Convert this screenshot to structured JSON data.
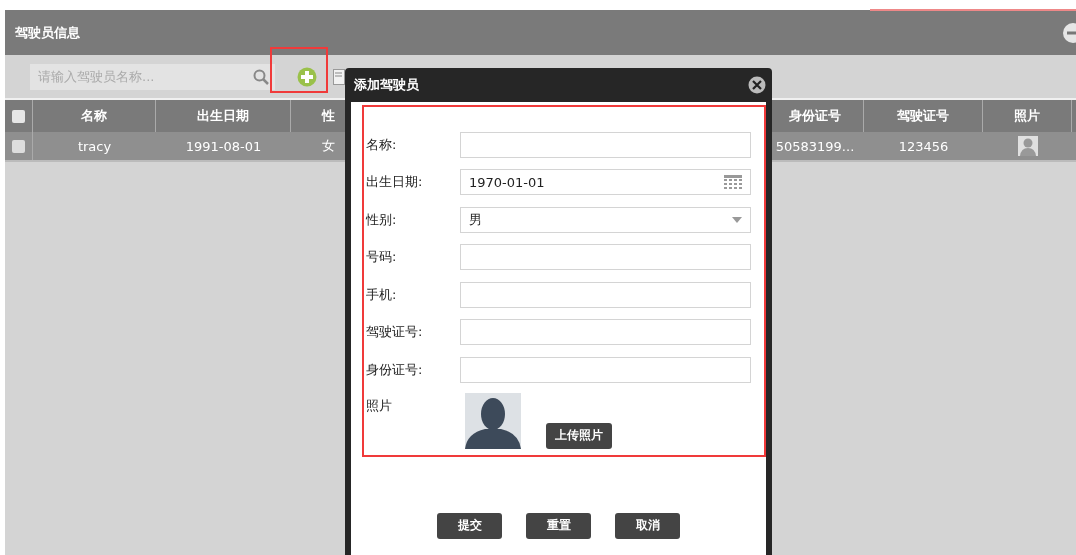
{
  "panel": {
    "title": "驾驶员信息"
  },
  "toolbar": {
    "search": {
      "placeholder": "请输入驾驶员名称..."
    }
  },
  "table": {
    "columns": [
      {
        "label": "名称",
        "kind": "text"
      },
      {
        "label": "出生日期",
        "kind": "text"
      },
      {
        "label": "性",
        "kind": "partial"
      },
      {
        "label": "身份证号",
        "kind": "text"
      },
      {
        "label": "驾驶证号",
        "kind": "text"
      },
      {
        "label": "照片",
        "kind": "photo"
      }
    ],
    "header_checked": false,
    "rows": [
      {
        "checked": false,
        "cells": [
          "tracy",
          "1991-08-01",
          "女",
          "50583199...",
          "123456"
        ]
      }
    ]
  },
  "dialog": {
    "title": "添加驾驶员",
    "fields": [
      {
        "kind": "text",
        "label": "名称:"
      },
      {
        "kind": "date",
        "label": "出生日期:",
        "value": "1970-01-01"
      },
      {
        "kind": "select",
        "label": "性别:",
        "value": "男"
      },
      {
        "kind": "text",
        "label": "号码:"
      },
      {
        "kind": "text",
        "label": "手机:"
      },
      {
        "kind": "text",
        "label": "驾驶证号:"
      },
      {
        "kind": "text",
        "label": "身份证号:"
      },
      {
        "kind": "photo",
        "label": "照片",
        "button": "上传照片"
      }
    ],
    "buttons": [
      "提交",
      "重置",
      "取消"
    ]
  }
}
